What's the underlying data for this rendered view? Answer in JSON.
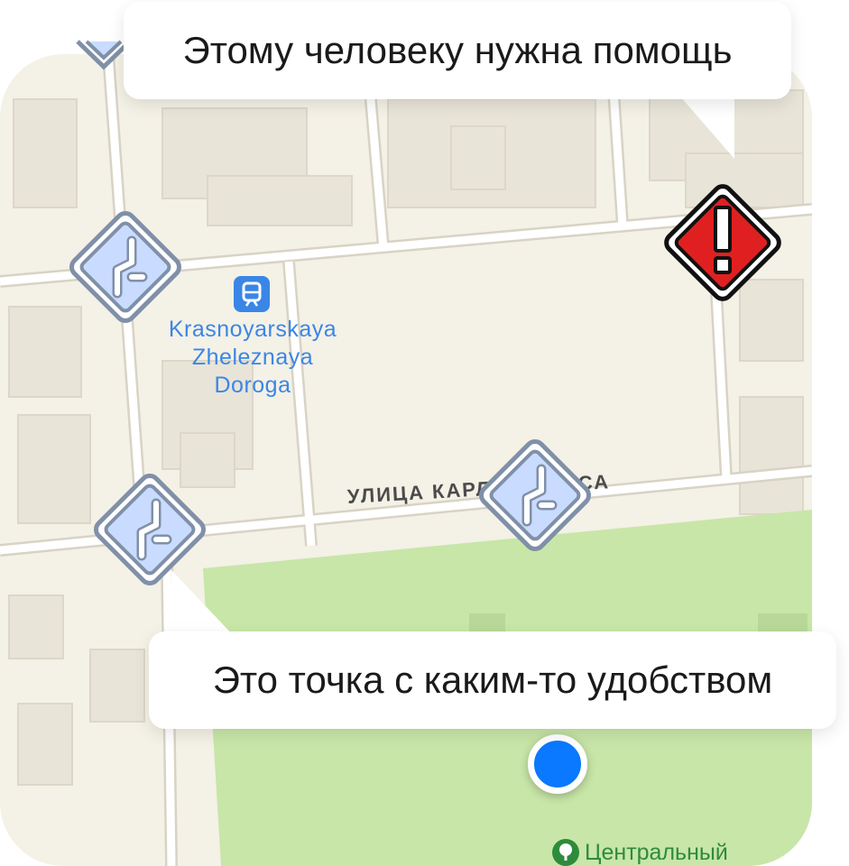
{
  "map": {
    "poi": {
      "name_lines": [
        "Krasnoyarskaya",
        "Zheleznaya",
        "Doroga"
      ],
      "icon": "train-station-icon",
      "color": "#3a86e6"
    },
    "street_label": "УЛИЦА КАРЛА МАРКСА",
    "park_label": "Центральный",
    "markers": [
      {
        "type": "amenity",
        "icon": "road-junction-icon",
        "color": "#c9dcff"
      },
      {
        "type": "amenity",
        "icon": "road-junction-icon",
        "color": "#c9dcff"
      },
      {
        "type": "amenity",
        "icon": "road-junction-icon",
        "color": "#c9dcff"
      },
      {
        "type": "help",
        "icon": "exclamation-icon",
        "color": "#e02020"
      }
    ],
    "user_location_color": "#0a78ff",
    "park_color": "#c8e6a8"
  },
  "callouts": {
    "help": "Этому человеку нужна помощь",
    "amenity": "Это точка с каким-то удобством"
  }
}
